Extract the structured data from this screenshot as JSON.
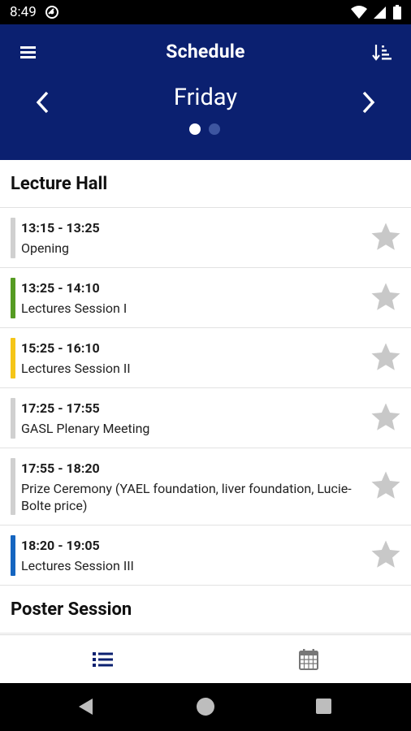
{
  "status_bar": {
    "time": "8:49",
    "icons": [
      "do-not-disturb-icon",
      "wifi-icon",
      "cellular-signal-icon",
      "battery-icon"
    ]
  },
  "header": {
    "title": "Schedule",
    "day": "Friday",
    "menu_icon": "hamburger-menu-icon",
    "sort_icon": "sort-icon",
    "prev_icon": "chevron-left-icon",
    "next_icon": "chevron-right-icon",
    "page_indicator": {
      "count": 2,
      "active": 1
    },
    "colors": {
      "background": "#0b2070",
      "text": "#ffffff"
    }
  },
  "sections": [
    {
      "title": "Lecture Hall",
      "sessions": [
        {
          "time": "13:15 - 13:25",
          "name": "Opening",
          "color": "#d0d0d0",
          "starred": false
        },
        {
          "time": "13:25 - 14:10",
          "name": "Lectures Session I",
          "color": "#559b22",
          "starred": false
        },
        {
          "time": "15:25 - 16:10",
          "name": "Lectures Session II",
          "color": "#f5c518",
          "starred": false
        },
        {
          "time": "17:25 - 17:55",
          "name": "GASL Plenary Meeting",
          "color": "#d0d0d0",
          "starred": false
        },
        {
          "time": "17:55 - 18:20",
          "name": "Prize Ceremony (YAEL foundation, liver foundation, Lucie-Bolte price)",
          "color": "#d0d0d0",
          "starred": false
        },
        {
          "time": "18:20 - 19:05",
          "name": "Lectures Session III",
          "color": "#1565c0",
          "starred": false
        }
      ]
    },
    {
      "title": "Poster Session",
      "sessions": []
    }
  ],
  "bottom_nav": {
    "items": [
      {
        "icon": "list-icon",
        "active": true
      },
      {
        "icon": "calendar-icon",
        "active": false
      }
    ],
    "active_color": "#0b2070",
    "inactive_color": "#777777"
  },
  "system_nav": {
    "icons": [
      "back-icon",
      "home-icon",
      "recents-icon"
    ]
  }
}
